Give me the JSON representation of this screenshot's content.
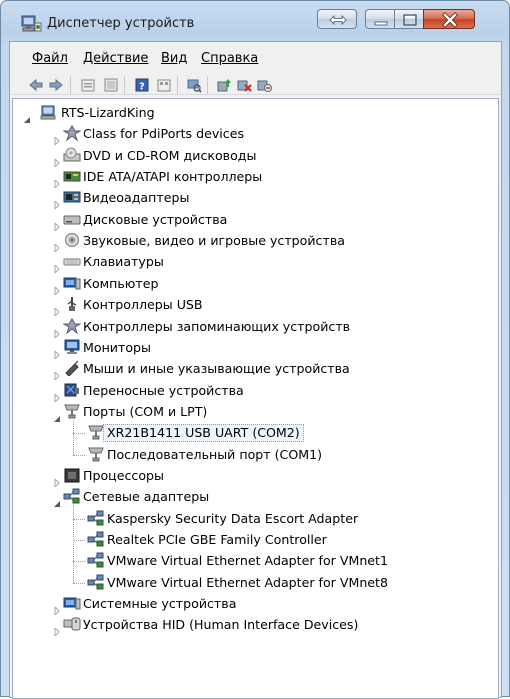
{
  "window": {
    "title": "Диспетчер устройств",
    "icon": "device-manager-icon"
  },
  "menu": [
    {
      "label": "Файл"
    },
    {
      "label": "Действие"
    },
    {
      "label": "Вид"
    },
    {
      "label": "Справка"
    }
  ],
  "toolbar": {
    "buttons": [
      "back-arrow-icon",
      "forward-arrow-icon",
      "properties-icon",
      "show-hidden-icon",
      "help-icon",
      "view-icon",
      "scan-hardware-icon",
      "update-driver-icon",
      "uninstall-icon",
      "disable-icon"
    ]
  },
  "tree": {
    "root": "RTS-LizardKing",
    "items": [
      {
        "label": "Class for PdiPorts devices",
        "icon": "pdiports-icon",
        "state": "collapsed"
      },
      {
        "label": "DVD и CD-ROM дисководы",
        "icon": "dvd-drive-icon",
        "state": "collapsed"
      },
      {
        "label": "IDE ATA/ATAPI контроллеры",
        "icon": "ide-controller-icon",
        "state": "collapsed"
      },
      {
        "label": "Видеоадаптеры",
        "icon": "display-adapter-icon",
        "state": "collapsed"
      },
      {
        "label": "Дисковые устройства",
        "icon": "disk-drive-icon",
        "state": "collapsed"
      },
      {
        "label": "Звуковые, видео и игровые устройства",
        "icon": "sound-icon",
        "state": "collapsed"
      },
      {
        "label": "Клавиатуры",
        "icon": "keyboard-icon",
        "state": "collapsed"
      },
      {
        "label": "Компьютер",
        "icon": "computer-icon",
        "state": "collapsed"
      },
      {
        "label": "Контроллеры USB",
        "icon": "usb-icon",
        "state": "collapsed"
      },
      {
        "label": "Контроллеры запоминающих устройств",
        "icon": "storage-controller-icon",
        "state": "collapsed"
      },
      {
        "label": "Мониторы",
        "icon": "monitor-icon",
        "state": "collapsed"
      },
      {
        "label": "Мыши и иные указывающие устройства",
        "icon": "mouse-icon",
        "state": "collapsed"
      },
      {
        "label": "Переносные устройства",
        "icon": "portable-device-icon",
        "state": "collapsed"
      },
      {
        "label": "Порты (COM и LPT)",
        "icon": "port-icon",
        "state": "expanded",
        "children": [
          {
            "label": "XR21B1411 USB UART (COM2)",
            "icon": "port-icon",
            "selected": true
          },
          {
            "label": "Последовательный порт (COM1)",
            "icon": "port-icon"
          }
        ]
      },
      {
        "label": "Процессоры",
        "icon": "processor-icon",
        "state": "collapsed"
      },
      {
        "label": "Сетевые адаптеры",
        "icon": "network-adapter-icon",
        "state": "expanded",
        "children": [
          {
            "label": "Kaspersky Security Data Escort Adapter",
            "icon": "network-adapter-icon"
          },
          {
            "label": "Realtek PCIe GBE Family Controller",
            "icon": "network-adapter-icon"
          },
          {
            "label": "VMware Virtual Ethernet Adapter for VMnet1",
            "icon": "network-adapter-icon"
          },
          {
            "label": "VMware Virtual Ethernet Adapter for VMnet8",
            "icon": "network-adapter-icon"
          }
        ]
      },
      {
        "label": "Системные устройства",
        "icon": "system-devices-icon",
        "state": "collapsed"
      },
      {
        "label": "Устройства HID (Human Interface Devices)",
        "icon": "hid-icon",
        "state": "collapsed"
      }
    ]
  }
}
